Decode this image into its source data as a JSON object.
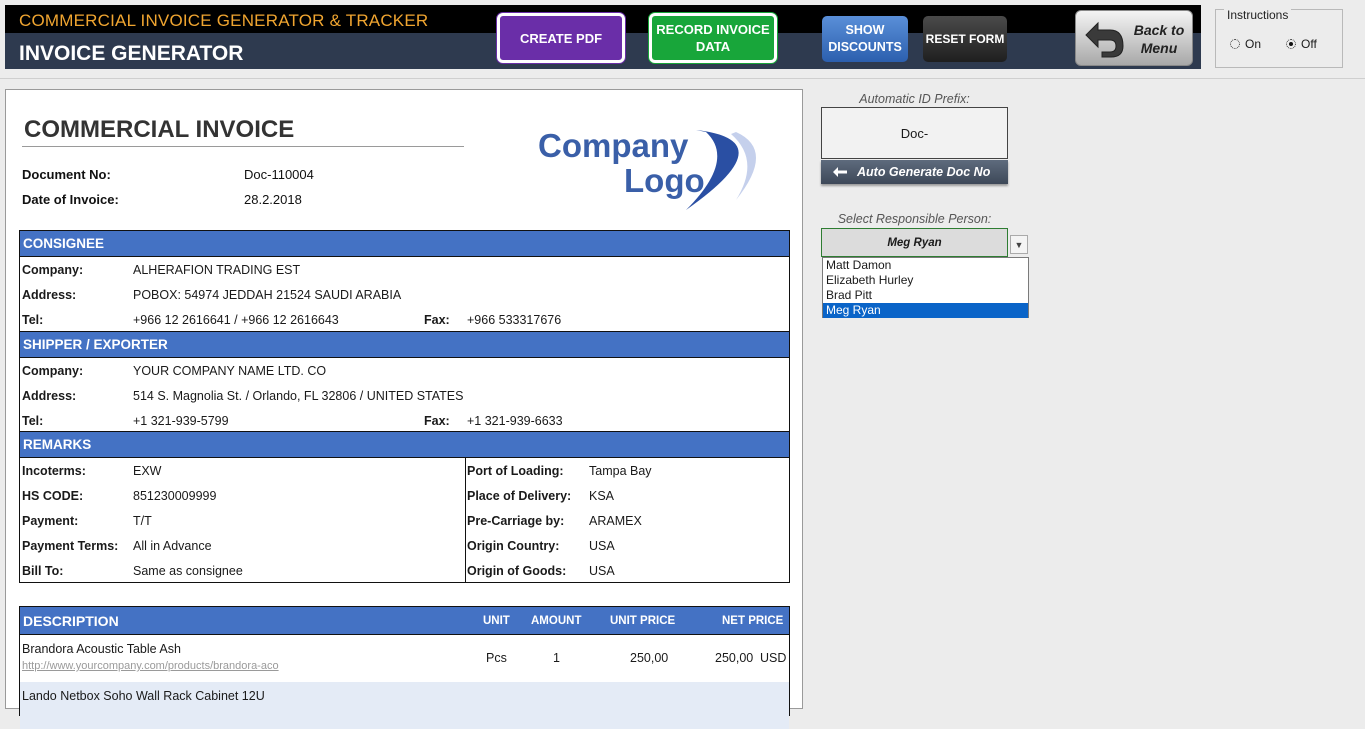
{
  "header": {
    "app_title": "COMMERCIAL INVOICE GENERATOR & TRACKER",
    "page_title": "INVOICE GENERATOR",
    "buttons": {
      "create_pdf": "CREATE PDF",
      "record_invoice": "RECORD INVOICE DATA",
      "show_discounts": "SHOW DISCOUNTS",
      "reset_form": "RESET FORM",
      "back_to_menu": "Back to Menu"
    },
    "colors": {
      "bar": "#2e3a4f",
      "title": "#f0a530",
      "pdf": "#6a2ea8",
      "record": "#18a63a"
    }
  },
  "instructions": {
    "label": "Instructions",
    "on": "On",
    "off": "Off",
    "selected": "Off"
  },
  "invoice": {
    "title": "COMMERCIAL INVOICE",
    "logo_line1": "Company",
    "logo_line2": "Logo",
    "document_no_label": "Document No:",
    "document_no": "Doc-110004",
    "date_label": "Date of Invoice:",
    "date": "28.2.2018",
    "consignee": {
      "heading": "CONSIGNEE",
      "company_label": "Company:",
      "company": "ALHERAFION TRADING EST",
      "address_label": "Address:",
      "address": "POBOX: 54974 JEDDAH 21524 SAUDI ARABIA",
      "tel_label": "Tel:",
      "tel": "+966 12 2616641 / +966 12 2616643",
      "fax_label": "Fax:",
      "fax": "+966 533317676"
    },
    "shipper": {
      "heading": "SHIPPER / EXPORTER",
      "company_label": "Company:",
      "company": "YOUR COMPANY NAME LTD. CO",
      "address_label": "Address:",
      "address": "514 S. Magnolia St. / Orlando, FL 32806 / UNITED STATES",
      "tel_label": "Tel:",
      "tel": "+1 321-939-5799",
      "fax_label": "Fax:",
      "fax": "+1 321-939-6633"
    },
    "remarks": {
      "heading": "REMARKS",
      "left": [
        {
          "label": "Incoterms:",
          "value": "EXW"
        },
        {
          "label": "HS CODE:",
          "value": "851230009999"
        },
        {
          "label": "Payment:",
          "value": "T/T"
        },
        {
          "label": "Payment Terms:",
          "value": "All in Advance"
        },
        {
          "label": "Bill To:",
          "value": "Same as consignee"
        }
      ],
      "right": [
        {
          "label": "Port of Loading:",
          "value": "Tampa Bay"
        },
        {
          "label": "Place of Delivery:",
          "value": "KSA"
        },
        {
          "label": "Pre-Carriage by:",
          "value": "ARAMEX"
        },
        {
          "label": "Origin Country:",
          "value": "USA"
        },
        {
          "label": "Origin of Goods:",
          "value": "USA"
        }
      ]
    },
    "items_table": {
      "headers": {
        "description": "DESCRIPTION",
        "unit": "UNIT",
        "amount": "AMOUNT",
        "unit_price": "UNIT PRICE",
        "net_price": "NET PRICE"
      },
      "rows": [
        {
          "description": "Brandora Acoustic Table Ash",
          "link": "http://www.yourcompany.com/products/brandora-aco",
          "unit": "Pcs",
          "amount": "1",
          "unit_price": "250,00",
          "net_price": "250,00",
          "currency": "USD"
        },
        {
          "description": "Lando Netbox Soho Wall Rack Cabinet 12U"
        }
      ]
    }
  },
  "side_panel": {
    "prefix_label": "Automatic ID Prefix:",
    "prefix_value": "Doc-",
    "auto_generate_label": "Auto Generate Doc No",
    "responsible_label": "Select Responsible Person:",
    "responsible_selected": "Meg Ryan",
    "responsible_options": [
      "Matt Damon",
      "Elizabeth Hurley",
      "Brad Pitt",
      "Meg Ryan"
    ]
  }
}
